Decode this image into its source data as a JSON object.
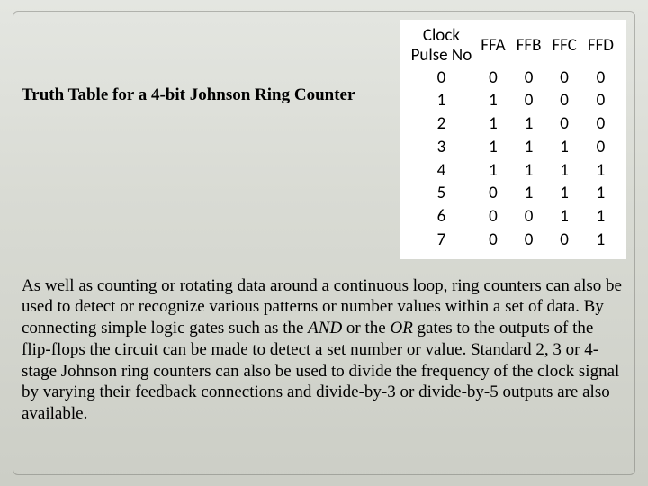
{
  "title": "Truth Table for a 4-bit Johnson Ring Counter",
  "table": {
    "headers": {
      "clock_line1": "Clock",
      "clock_line2": "Pulse No",
      "ffa": "FFA",
      "ffb": "FFB",
      "ffc": "FFC",
      "ffd": "FFD"
    },
    "rows": [
      {
        "n": "0",
        "a": "0",
        "b": "0",
        "c": "0",
        "d": "0"
      },
      {
        "n": "1",
        "a": "1",
        "b": "0",
        "c": "0",
        "d": "0"
      },
      {
        "n": "2",
        "a": "1",
        "b": "1",
        "c": "0",
        "d": "0"
      },
      {
        "n": "3",
        "a": "1",
        "b": "1",
        "c": "1",
        "d": "0"
      },
      {
        "n": "4",
        "a": "1",
        "b": "1",
        "c": "1",
        "d": "1"
      },
      {
        "n": "5",
        "a": "0",
        "b": "1",
        "c": "1",
        "d": "1"
      },
      {
        "n": "6",
        "a": "0",
        "b": "0",
        "c": "1",
        "d": "1"
      },
      {
        "n": "7",
        "a": "0",
        "b": "0",
        "c": "0",
        "d": "1"
      }
    ]
  },
  "paragraph": {
    "p1": "As well as counting or rotating data around a continuous loop, ring counters can also be used to detect or recognize various patterns or number values within a set of data. By connecting simple logic gates such as the ",
    "and_word": "AND",
    "p2": " or the ",
    "or_word": "OR",
    "p3": " gates to the outputs of the flip-flops the circuit can be made to detect a set number or value. Standard 2, 3 or 4-stage Johnson ring counters can also be used to divide the frequency of the clock signal by varying their feedback connections and divide-by-3 or divide-by-5 outputs are also available."
  },
  "chart_data": {
    "type": "table",
    "title": "Truth Table for a 4-bit Johnson Ring Counter",
    "columns": [
      "Clock Pulse No",
      "FFA",
      "FFB",
      "FFC",
      "FFD"
    ],
    "rows": [
      [
        0,
        0,
        0,
        0,
        0
      ],
      [
        1,
        1,
        0,
        0,
        0
      ],
      [
        2,
        1,
        1,
        0,
        0
      ],
      [
        3,
        1,
        1,
        1,
        0
      ],
      [
        4,
        1,
        1,
        1,
        1
      ],
      [
        5,
        0,
        1,
        1,
        1
      ],
      [
        6,
        0,
        0,
        1,
        1
      ],
      [
        7,
        0,
        0,
        0,
        1
      ]
    ]
  }
}
